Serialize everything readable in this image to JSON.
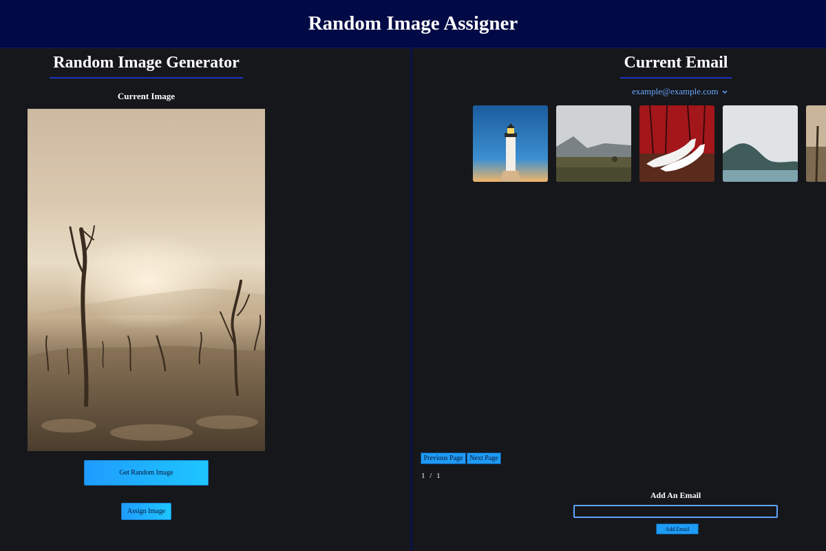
{
  "header": {
    "title": "Random Image Assigner"
  },
  "left": {
    "title": "Random Image Generator",
    "current_image_label": "Current Image",
    "get_random_label": "Get Random Image",
    "assign_label": "Assign Image"
  },
  "right": {
    "title": "Current Email",
    "selected_email": "example@example.com",
    "previous_label": "Previous Page",
    "next_label": "Next Page",
    "page_current": "1",
    "page_separator": "/",
    "page_total": "1",
    "add_email_heading": "Add An Email",
    "add_email_input_value": "",
    "add_email_button": "Add Email"
  },
  "colors": {
    "header_bg": "#020a45",
    "page_bg": "#16171b",
    "accent_underline": "#1c34c4",
    "button_gradient_start": "#1f9cff",
    "button_gradient_end": "#1ec6ff",
    "link_blue": "#6aa7ff"
  }
}
